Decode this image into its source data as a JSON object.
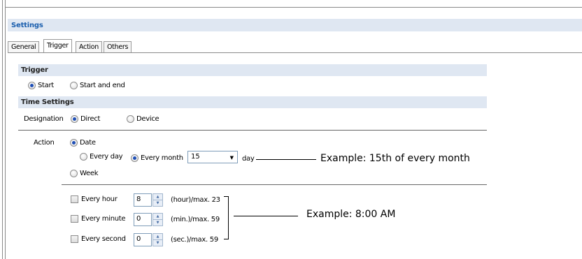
{
  "settings": {
    "title": "Settings"
  },
  "tabs": [
    {
      "label": "General",
      "active": false
    },
    {
      "label": "Trigger",
      "active": true
    },
    {
      "label": "Action",
      "active": false
    },
    {
      "label": "Others",
      "active": false
    }
  ],
  "trigger": {
    "title": "Trigger",
    "options": [
      {
        "label": "Start",
        "checked": true
      },
      {
        "label": "Start and end",
        "checked": false
      }
    ]
  },
  "time_settings": {
    "title": "Time Settings",
    "designation_label": "Designation",
    "designation_options": [
      {
        "label": "Direct",
        "checked": true
      },
      {
        "label": "Device",
        "checked": false
      }
    ]
  },
  "action": {
    "label": "Action",
    "date_label": "Date",
    "every_day_label": "Every day",
    "every_month_label": "Every month",
    "day_value": "15",
    "day_suffix": "day",
    "week_label": "Week"
  },
  "time_rows": [
    {
      "label": "Every hour",
      "value": "8",
      "suffix": "(hour)/max. 23"
    },
    {
      "label": "Every minute",
      "value": "0",
      "suffix": "(min.)/max. 59"
    },
    {
      "label": "Every second",
      "value": "0",
      "suffix": "(sec.)/max. 59"
    }
  ],
  "annotations": {
    "month_example": "Example: 15th of every month",
    "time_example": "Example: 8:00 AM"
  }
}
